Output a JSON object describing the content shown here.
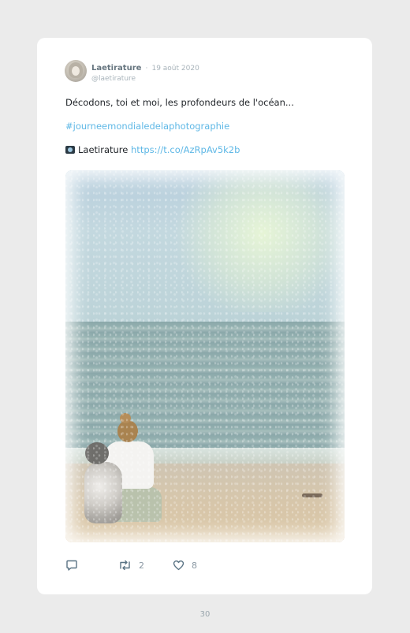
{
  "tweet": {
    "author_name": "Laetirature",
    "separator": "·",
    "date": "19 août 2020",
    "handle": "@laetirature",
    "text_line1": "Décodons, toi et moi, les profondeurs de l'océan...",
    "hashtag": "#journeemondialedelaphotographie",
    "source_icon": "camera-icon",
    "source_name": "Laetirature",
    "link": "https://t.co/AzRpAv5k2b",
    "photo_alt": "photo"
  },
  "actions": {
    "reply_icon": "reply-icon",
    "retweet_icon": "retweet-icon",
    "retweet_count": "2",
    "like_icon": "heart-icon",
    "like_count": "8"
  },
  "page": {
    "number": "30"
  },
  "colors": {
    "accent": "#5fb8e6",
    "text": "#1f2328",
    "muted": "#a9b4bb",
    "background": "#ebebeb",
    "card": "#ffffff"
  }
}
